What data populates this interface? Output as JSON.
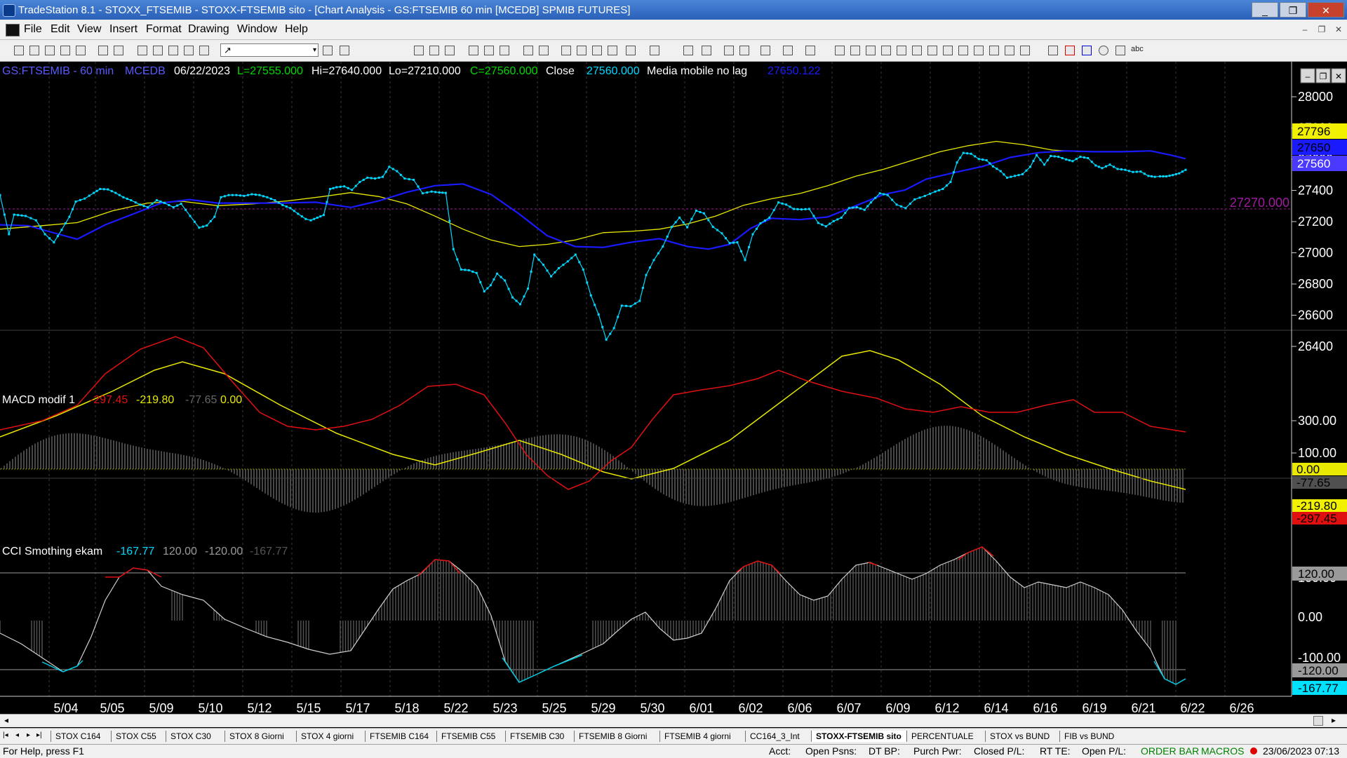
{
  "window": {
    "title": "TradeStation 8.1 - STOXX_FTSEMIB - STOXX-FTSEMIB sito - [Chart Analysis - GS:FTSEMIB  60 min  [MCEDB] SPMIB FUTURES]",
    "minimize": "_",
    "restore": "❐",
    "close": "✕"
  },
  "menu": {
    "items": [
      "File",
      "Edit",
      "View",
      "Insert",
      "Format",
      "Drawing",
      "Window",
      "Help"
    ],
    "mdi": [
      "–",
      "❐",
      "✕"
    ]
  },
  "toolbar": {
    "combo_value": "↗",
    "combo_arrow": "▾",
    "text_tool": "abc"
  },
  "chart": {
    "header": {
      "symbol": "GS:FTSEMIB - 60 min",
      "code": "MCEDB",
      "date": "06/22/2023",
      "last": "L=27555.000",
      "high": "Hi=27640.000",
      "low": "Lo=27210.000",
      "close": "C=27560.000",
      "close_label": "Close",
      "close_value": "27560.000",
      "ma_label": "Media mobile no lag",
      "ma_value": "27650.122"
    },
    "price_ticks": [
      "28000",
      "27800",
      "27600",
      "27400",
      "27200",
      "27000",
      "26800",
      "26600",
      "26400"
    ],
    "price_markers": {
      "yellow": "27796",
      "blue": "27650",
      "close": "27560"
    },
    "ref_line_label": "27270.000",
    "mini_buttons": [
      "–",
      "❐",
      "✕"
    ]
  },
  "macd": {
    "title": "MACD modif 1",
    "v1": "-297.45",
    "v2": "-219.80",
    "v3": "-77.65",
    "v4": "0.00",
    "ticks": [
      "300.00",
      "100.00"
    ],
    "markers": [
      "0.00",
      "-77.65",
      "-219.80",
      "-297.45"
    ]
  },
  "cci": {
    "title": "CCI Smothing ekam",
    "v1": "-167.77",
    "v2": "120.00",
    "v3": "-120.00",
    "v4": "-167.77",
    "ticks": [
      "100.00",
      "0.00",
      "-100.00"
    ],
    "markers": [
      "120.00",
      "-120.00",
      "-167.77"
    ]
  },
  "dates": [
    "5/04",
    "5/05",
    "5/09",
    "5/10",
    "5/12",
    "5/15",
    "5/17",
    "5/18",
    "5/22",
    "5/23",
    "5/25",
    "5/29",
    "5/30",
    "6/01",
    "6/02",
    "6/06",
    "6/07",
    "6/09",
    "6/12",
    "6/14",
    "6/16",
    "6/19",
    "6/21",
    "6/22",
    "6/26"
  ],
  "tabs": [
    "STOX C164",
    "STOX C55",
    "STOX  C30",
    "STOX  8 Giorni",
    "STOX 4 giorni",
    "FTSEMIB C164",
    "FTSEMIB C55",
    "FTSEMIB C30",
    "FTSEMIB  8 Giorni",
    "FTSEMIB  4 giorni",
    "CC164_3_Int",
    "STOXX-FTSEMIB sito",
    "PERCENTUALE",
    "STOX vs BUND",
    "FIB vs BUND"
  ],
  "tab_nav": [
    "|◂",
    "◂",
    "▸",
    "▸|"
  ],
  "status": {
    "help": "For Help, press F1",
    "acct": "Acct:",
    "open_psns": "Open Psns:",
    "dt_bp": "DT BP:",
    "purch_pwr": "Purch Pwr:",
    "closed_pl": "Closed P/L:",
    "rt_te": "RT TE:",
    "open_pl": "Open P/L:",
    "order_bar": "ORDER BAR",
    "macros": "MACROS",
    "datetime": "23/06/2023 07:13"
  },
  "colors": {
    "bg": "#000000",
    "price_line": "#00d8ff",
    "ma_blue": "#1a1aff",
    "ma_yellow": "#e8e800",
    "macd_red": "#e01010",
    "hist": "#6a6a6a",
    "ref_line": "#a01aa0",
    "green": "#00d800",
    "order_bar": "#008000"
  }
}
